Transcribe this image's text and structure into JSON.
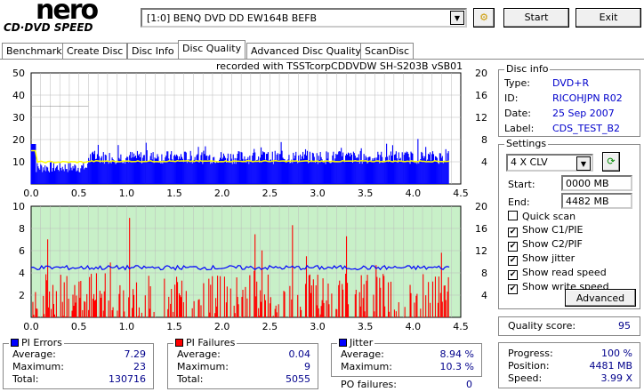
{
  "header": {
    "logo_top": "nero",
    "logo_bottom": "CD·DVD SPEED",
    "drive": "[1:0]  BENQ DVD DD EW164B BEFB",
    "start": "Start",
    "exit": "Exit"
  },
  "tabs": [
    "Benchmark",
    "Create Disc",
    "Disc Info",
    "Disc Quality",
    "Advanced Disc Quality",
    "ScanDisc"
  ],
  "active_tab": "Disc Quality",
  "recorded_with": "recorded with TSSTcorpCDDVDW SH-S203B  vSB01",
  "disc_info": {
    "title": "Disc info",
    "type_label": "Type:",
    "type": "DVD+R",
    "id_label": "ID:",
    "id": "RICOHJPN R02",
    "date_label": "Date:",
    "date": "25 Sep 2007",
    "label_label": "Label:",
    "label": "CDS_TEST_B2"
  },
  "settings": {
    "title": "Settings",
    "speed": "4 X CLV",
    "start_label": "Start:",
    "start": "0000 MB",
    "end_label": "End:",
    "end": "4482 MB",
    "quick_scan": "Quick scan",
    "show_c1": "Show C1/PIE",
    "show_c2": "Show C2/PIF",
    "show_jitter": "Show jitter",
    "show_read": "Show read speed",
    "show_write": "Show write speed",
    "advanced": "Advanced",
    "checks": [
      false,
      true,
      true,
      true,
      true,
      true
    ]
  },
  "quality": {
    "label": "Quality score:",
    "value": "95"
  },
  "pi_errors": {
    "title": "PI Errors",
    "avg_label": "Average:",
    "avg": "7.29",
    "max_label": "Maximum:",
    "max": "23",
    "total_label": "Total:",
    "total": "130716",
    "color": "#0000ff"
  },
  "pi_failures": {
    "title": "PI Failures",
    "avg_label": "Average:",
    "avg": "0.04",
    "max_label": "Maximum:",
    "max": "9",
    "total_label": "Total:",
    "total": "5055",
    "color": "#ff0000"
  },
  "jitter": {
    "title": "Jitter",
    "avg_label": "Average:",
    "avg": "8.94 %",
    "max_label": "Maximum:",
    "max": "10.3 %",
    "po_label": "PO failures:",
    "po": "0",
    "color": "#0000ff"
  },
  "progress": {
    "progress_label": "Progress:",
    "progress": "100 %",
    "position_label": "Position:",
    "position": "4481 MB",
    "speed_label": "Speed:",
    "speed": "3.99 X"
  },
  "chart_data": [
    {
      "type": "bar",
      "name": "PI Errors",
      "x_ticks": [
        "0.0",
        "0.5",
        "1.0",
        "1.5",
        "2.0",
        "2.5",
        "3.0",
        "3.5",
        "4.0",
        "4.5"
      ],
      "y_left_ticks": [
        "50",
        "40",
        "30",
        "20",
        "10"
      ],
      "y_right_ticks": [
        "20",
        "16",
        "12",
        "8",
        "4"
      ],
      "xlim": [
        0,
        4.5
      ],
      "ylim": [
        0,
        50
      ],
      "y2lim": [
        0,
        20
      ],
      "pi_avg": 7.29,
      "pi_max": 23,
      "read_speed_x": 4
    },
    {
      "type": "bar",
      "name": "PI Failures",
      "x_ticks": [
        "0.0",
        "0.5",
        "1.0",
        "1.5",
        "2.0",
        "2.5",
        "3.0",
        "3.5",
        "4.0",
        "4.5"
      ],
      "y_left_ticks": [
        "10",
        "8",
        "6",
        "4",
        "2"
      ],
      "y_right_ticks": [
        "20",
        "16",
        "12",
        "8",
        "4"
      ],
      "xlim": [
        0,
        4.5
      ],
      "ylim": [
        0,
        10
      ],
      "y2lim": [
        0,
        20
      ],
      "pif_max": 9,
      "jitter_avg": 8.94
    }
  ]
}
